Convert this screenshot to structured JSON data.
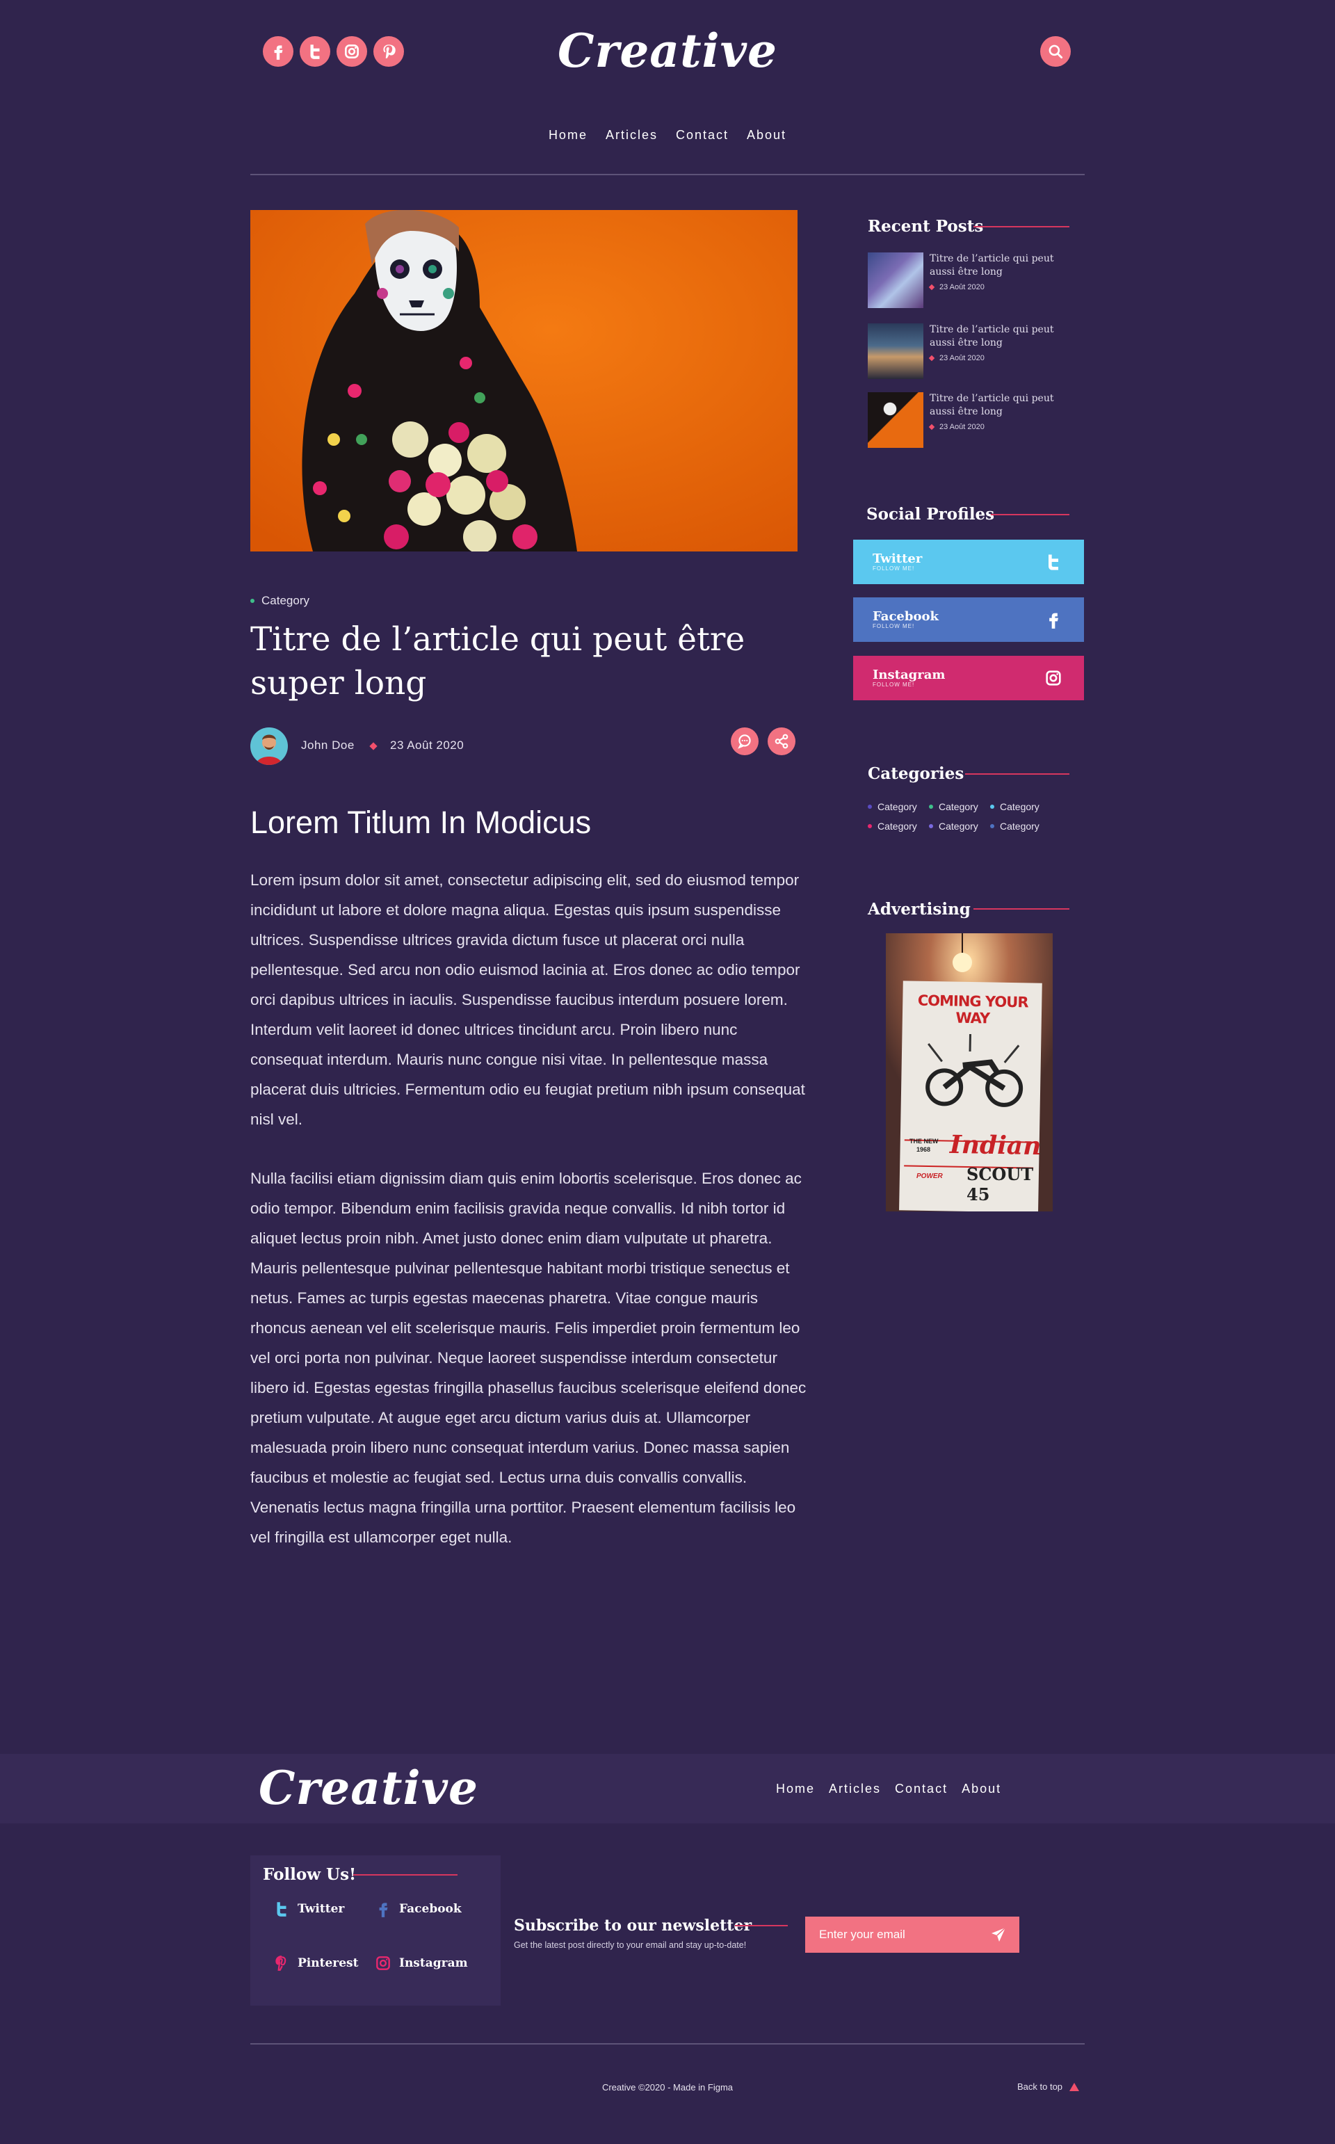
{
  "header": {
    "logo": "Creative",
    "social_icons": [
      "facebook-icon",
      "twitter-icon",
      "instagram-icon",
      "pinterest-icon"
    ],
    "nav": [
      "Home",
      "Articles",
      "Contact",
      "About"
    ]
  },
  "article": {
    "category": "Category",
    "title": "Titre de l’article qui peut être super long",
    "author": "John Doe",
    "date": "23 Août 2020",
    "heading": "Lorem Titlum In Modicus",
    "paragraphs": [
      "Lorem ipsum dolor sit amet, consectetur adipiscing elit, sed do eiusmod tempor incididunt ut labore et dolore magna aliqua. Egestas quis ipsum suspendisse ultrices. Suspendisse ultrices gravida dictum fusce ut placerat orci nulla pellentesque. Sed arcu non odio euismod lacinia at. Eros donec ac odio tempor orci dapibus ultrices in iaculis. Suspendisse faucibus interdum posuere lorem. Interdum velit laoreet id donec ultrices tincidunt arcu. Proin libero nunc consequat interdum. Mauris nunc congue nisi vitae. In pellentesque massa placerat duis ultricies. Fermentum odio eu feugiat pretium nibh ipsum consequat nisl vel.",
      "Nulla facilisi etiam dignissim diam quis enim lobortis scelerisque. Eros donec ac odio tempor. Bibendum enim facilisis gravida neque convallis. Id nibh tortor id aliquet lectus proin nibh. Amet justo donec enim diam vulputate ut pharetra. Mauris pellentesque pulvinar pellentesque habitant morbi tristique senectus et netus. Fames ac turpis egestas maecenas pharetra. Vitae congue mauris rhoncus aenean vel elit scelerisque mauris. Felis imperdiet proin fermentum leo vel orci porta non pulvinar. Neque laoreet suspendisse interdum consectetur libero id. Egestas egestas fringilla phasellus faucibus scelerisque eleifend donec pretium vulputate. At augue eget arcu dictum varius duis at. Ullamcorper malesuada proin libero nunc consequat interdum varius. Donec massa sapien faucibus et molestie ac feugiat sed. Lectus urna duis convallis convallis. Venenatis lectus magna fringilla urna porttitor. Praesent elementum facilisis leo vel fringilla est ullamcorper eget nulla."
    ]
  },
  "sidebar": {
    "recent_title": "Recent Posts",
    "recent_posts": [
      {
        "title": "Titre de l’article qui peut aussi être long",
        "date": "23 Août 2020"
      },
      {
        "title": "Titre de l’article qui peut aussi être long",
        "date": "23 Août 2020"
      },
      {
        "title": "Titre de l’article qui peut aussi être long",
        "date": "23 Août 2020"
      }
    ],
    "social_title": "Social Profiles",
    "social": [
      {
        "name": "Twitter",
        "sub": "FOLLOW ME!",
        "color": "#5bc8ef"
      },
      {
        "name": "Facebook",
        "sub": "FOLLOW ME!",
        "color": "#4e73c1"
      },
      {
        "name": "Instagram",
        "sub": "FOLLOW ME!",
        "color": "#d02b6f"
      }
    ],
    "categories_title": "Categories",
    "categories": [
      "Category",
      "Category",
      "Category",
      "Category",
      "Category",
      "Category"
    ],
    "advertising_title": "Advertising",
    "ad_text": {
      "top": "COMING YOUR WAY",
      "brand": "Indian",
      "model": "SCOUT 45",
      "new": "THE NEW",
      "year": "1968",
      "power": "POWER"
    }
  },
  "footer": {
    "logo": "Creative",
    "nav": [
      "Home",
      "Articles",
      "Contact",
      "About"
    ],
    "follow_title": "Follow Us!",
    "follow": [
      "Twitter",
      "Facebook",
      "Pinterest",
      "Instagram"
    ],
    "newsletter_title": "Subscribe to our newsletter",
    "newsletter_sub": "Get the latest post directly to your email and stay up-to-date!",
    "email_placeholder": "Enter your email",
    "copyright": "Creative ©2020 - Made in Figma",
    "back_to_top": "Back to top"
  },
  "colors": {
    "background": "#30244d",
    "footer_band": "#372a56",
    "accent": "#f27282",
    "line": "#d7365e"
  }
}
